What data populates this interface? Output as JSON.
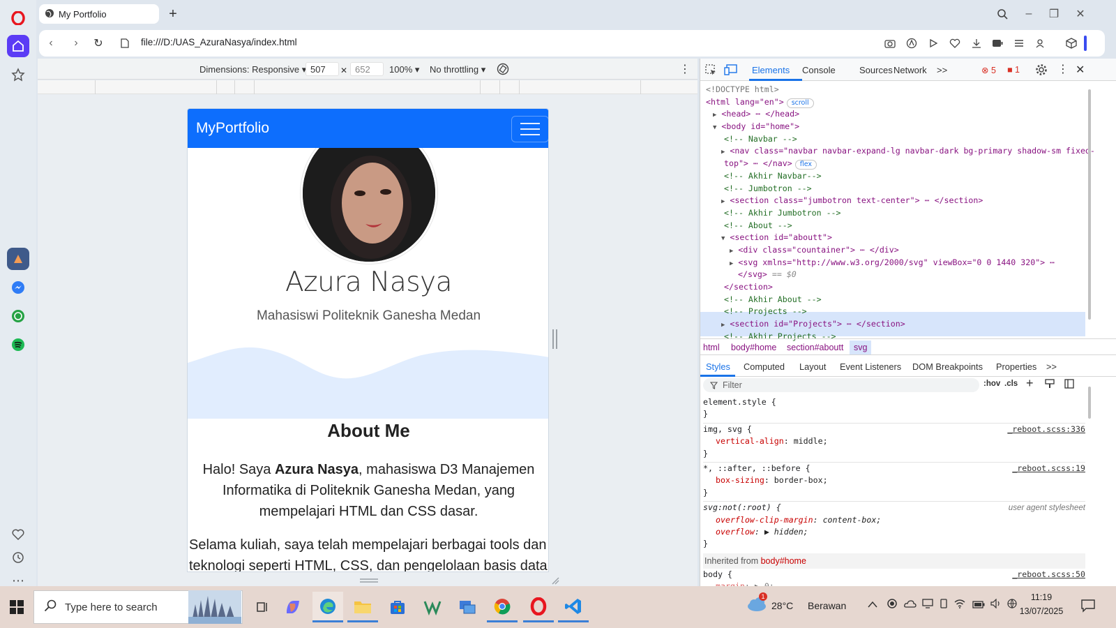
{
  "browser": {
    "tab_title": "My Portfolio",
    "url": "file:///D:/UAS_AzuraNasya/index.html"
  },
  "device_toolbar": {
    "dimensions_label": "Dimensions: Responsive",
    "width": "507",
    "height": "652",
    "zoom": "100%",
    "throttling": "No throttling"
  },
  "page": {
    "brand": "MyPortfolio",
    "name": "Azura Nasya",
    "subtitle": "Mahasiswi Politeknik Ganesha Medan",
    "about_title": "About Me",
    "about_p1_pre": "Halo! Saya ",
    "about_p1_bold": "Azura Nasya",
    "about_p1_post": ", mahasiswa D3 Manajemen Informatika di Politeknik Ganesha Medan, yang mempelajari HTML dan CSS dasar.",
    "about_p2_line1": "Selama kuliah, saya telah mempelajari berbagai tools dan",
    "about_p2_line2": "teknologi seperti HTML, CSS, dan pengelolaan basis data."
  },
  "devtools": {
    "tabs": [
      "Elements",
      "Console",
      "Sources",
      "Network"
    ],
    "more": ">>",
    "errors": "5",
    "warnings": "1",
    "dom": {
      "doctype": "<!DOCTYPE html>",
      "html_open": "<html lang=\"en\">",
      "badge_scroll": "scroll",
      "head": "<head> ⋯ </head>",
      "body_open": "<body id=\"home\">",
      "c_navbar": "<!-- Navbar -->",
      "nav_line1": "<nav class=\"navbar navbar-expand-lg navbar-dark bg-primary shadow-sm fixed-",
      "nav_line2": "top\"> ⋯ </nav>",
      "badge_flex": "flex",
      "c_akhir_navbar": "<!-- Akhir Navbar-->",
      "c_jumbotron": "<!-- Jumbotron -->",
      "section_jumbo": "<section class=\"jumbotron text-center\"> ⋯ </section>",
      "c_akhir_jumbo": "<!-- Akhir Jumbotron -->",
      "c_about": "<!-- About -->",
      "section_about": "<section id=\"aboutt\">",
      "div_countainer": "<div class=\"countainer\"> ⋯ </div>",
      "svg_line1": "<svg xmlns=\"http://www.w3.org/2000/svg\" viewBox=\"0 0 1440 320\"> ⋯",
      "svg_line2": "</svg>",
      "svg_eq": "== $0",
      "section_close": "</section>",
      "c_akhir_about": "<!-- Akhir About -->",
      "c_projects": "<!-- Projects -->",
      "section_projects": "<section id=\"Projects\"> ⋯ </section>",
      "c_akhir_projects": "<!-- Akhir Projects -->"
    },
    "breadcrumbs": [
      "html",
      "body#home",
      "section#aboutt",
      "svg"
    ],
    "styles_tabs": [
      "Styles",
      "Computed",
      "Layout",
      "Event Listeners",
      "DOM Breakpoints",
      "Properties"
    ],
    "filter_placeholder": "Filter",
    "hov": ":hov",
    "cls": ".cls",
    "rules": {
      "r1_sel": "element.style {",
      "r2_sel": "img, svg {",
      "r2_src": "_reboot.scss:336",
      "r2_prop": "vertical-align",
      "r2_val": "middle;",
      "r3_sel": "*, ::after, ::before {",
      "r3_src": "_reboot.scss:19",
      "r3_prop": "box-sizing",
      "r3_val": "border-box;",
      "r4_sel": "svg:not(:root) {",
      "r4_src": "user agent stylesheet",
      "r4_prop1": "overflow-clip-margin",
      "r4_val1": "content-box;",
      "r4_prop2": "overflow",
      "r4_val2": "▶ hidden;",
      "inherited_label": "Inherited from ",
      "inherited_from": "body#home",
      "r5_sel": "body {",
      "r5_src": "_reboot.scss:50",
      "r5_prop": "margin",
      "r5_val": "▶ 0;",
      "close": "}"
    }
  },
  "taskbar": {
    "search_placeholder": "Type here to search",
    "weather_temp": "28°C",
    "weather_text": "Berawan",
    "time": "11:19",
    "date": "13/07/2025",
    "weather_badge": "1"
  }
}
